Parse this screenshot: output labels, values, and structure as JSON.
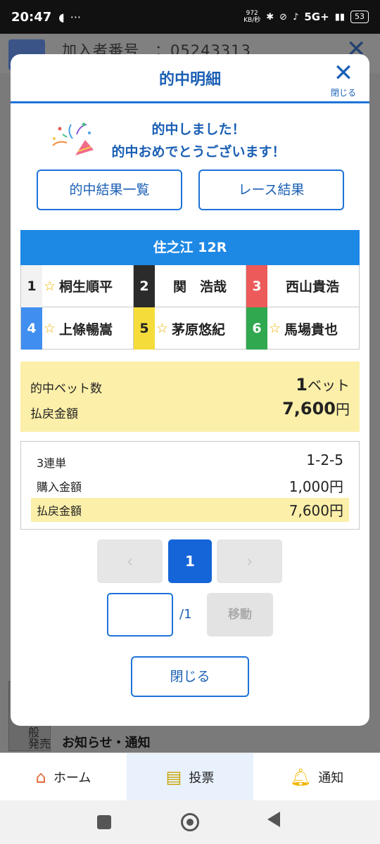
{
  "status_bar": {
    "time": "20:47",
    "speed_value": "972",
    "speed_unit": "KB/秒",
    "network": "5G+",
    "battery": "53"
  },
  "background": {
    "member_label": "加入者番号　：05243313",
    "notice": "お知らせ・通知",
    "left_text_1": "般",
    "left_text_2": "発売"
  },
  "modal": {
    "title": "的中明細",
    "close_label": "閉じる",
    "congrats_line1": "的中しました！",
    "congrats_line2": "的中おめでとうございます！",
    "btn_results": "的中結果一覧",
    "btn_race": "レース結果",
    "race_title": "住之江 12R",
    "racers": [
      {
        "num": "1",
        "name": "桐生順平",
        "star": true,
        "num_bg": "#f2f2f2",
        "num_color": "#222"
      },
      {
        "num": "2",
        "name": "関　浩哉",
        "star": false,
        "num_bg": "#2b2b2b",
        "num_color": "#ffffff"
      },
      {
        "num": "3",
        "name": "西山貴浩",
        "star": false,
        "num_bg": "#ec5a5a",
        "num_color": "#ffffff"
      },
      {
        "num": "4",
        "name": "上條暢嵩",
        "star": true,
        "num_bg": "#3f8ef0",
        "num_color": "#ffffff"
      },
      {
        "num": "5",
        "name": "茅原悠紀",
        "star": true,
        "num_bg": "#f5dc3a",
        "num_color": "#222"
      },
      {
        "num": "6",
        "name": "馬場貴也",
        "star": true,
        "num_bg": "#2fa84f",
        "num_color": "#ffffff"
      }
    ],
    "summary": {
      "bet_count_label": "的中ベット数",
      "bet_count_value": "1",
      "bet_count_unit": "ベット",
      "payout_label": "払戻金額",
      "payout_value": "7,600",
      "payout_unit": "円"
    },
    "detail": {
      "bet_type_label": "3連単",
      "bet_type_value": "1-2-5",
      "purchase_label": "購入金額",
      "purchase_value": "1,000円",
      "payout_label": "払戻金額",
      "payout_value": "7,600円"
    },
    "pager": {
      "prev": "‹",
      "current": "1",
      "next": "›",
      "input_value": "",
      "total": "/1",
      "move_label": "移動"
    },
    "bottom_close": "閉じる"
  },
  "bottom_nav": {
    "home": "ホーム",
    "vote": "投票",
    "notify": "通知"
  },
  "colors": {
    "accent": "#1e73d8",
    "race_bar": "#1e88e5",
    "highlight": "#fcefa9"
  }
}
